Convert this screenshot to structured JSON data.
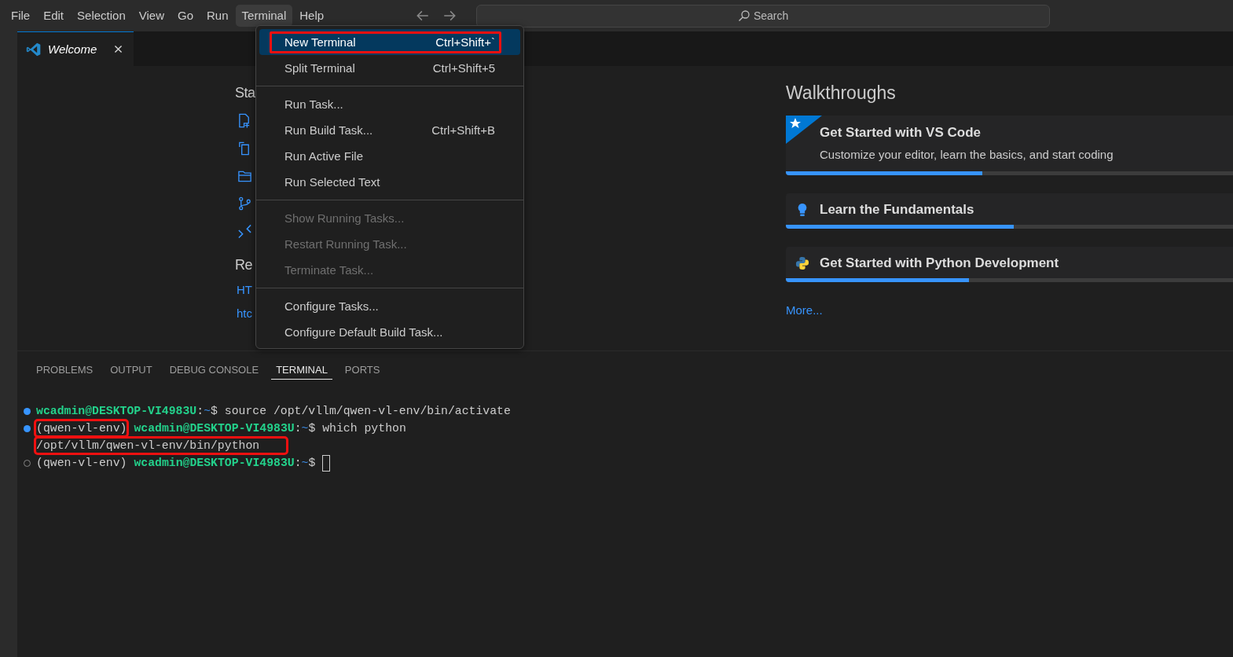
{
  "menu_bar": {
    "items": [
      {
        "label": "File",
        "selected": false
      },
      {
        "label": "Edit",
        "selected": false
      },
      {
        "label": "Selection",
        "selected": false
      },
      {
        "label": "View",
        "selected": false
      },
      {
        "label": "Go",
        "selected": false
      },
      {
        "label": "Run",
        "selected": false
      },
      {
        "label": "Terminal",
        "selected": true
      },
      {
        "label": "Help",
        "selected": false
      }
    ]
  },
  "command_center": {
    "label": "Search"
  },
  "tabs": [
    {
      "label": "Welcome",
      "selected": true
    }
  ],
  "welcome": {
    "start_heading": "Sta",
    "start_icons": [
      {
        "kind": "file"
      },
      {
        "kind": "clone"
      },
      {
        "kind": "folder"
      },
      {
        "kind": "branch"
      },
      {
        "kind": "remote"
      }
    ],
    "recent_heading": "Re",
    "recent_links": [
      "HT",
      "htc"
    ]
  },
  "walkthroughs": {
    "heading": "Walkthroughs",
    "items": [
      {
        "kind": "featured",
        "title": "Get Started with VS Code",
        "description": "Customize your editor, learn the basics, and start coding",
        "level": 0.44
      },
      {
        "kind": "bulb",
        "title": "Learn the Fundamentals",
        "level": 0.51
      },
      {
        "kind": "python",
        "title": "Get Started with Python Development",
        "level": 0.41
      }
    ],
    "more": "More..."
  },
  "menu": {
    "items": [
      {
        "kind": "item",
        "label": "New Terminal",
        "shortcut": "Ctrl+Shift+`",
        "selected": true,
        "disabled": false,
        "annotated": true
      },
      {
        "kind": "item",
        "label": "Split Terminal",
        "shortcut": "Ctrl+Shift+5",
        "selected": false,
        "disabled": false,
        "annotated": false
      },
      {
        "kind": "separator"
      },
      {
        "kind": "item",
        "label": "Run Task...",
        "selected": false,
        "disabled": false,
        "annotated": false
      },
      {
        "kind": "item",
        "label": "Run Build Task...",
        "shortcut": "Ctrl+Shift+B",
        "selected": false,
        "disabled": false,
        "annotated": false
      },
      {
        "kind": "item",
        "label": "Run Active File",
        "selected": false,
        "disabled": false,
        "annotated": false
      },
      {
        "kind": "item",
        "label": "Run Selected Text",
        "selected": false,
        "disabled": false,
        "annotated": false
      },
      {
        "kind": "separator"
      },
      {
        "kind": "item",
        "label": "Show Running Tasks...",
        "selected": false,
        "disabled": true,
        "annotated": false
      },
      {
        "kind": "item",
        "label": "Restart Running Task...",
        "selected": false,
        "disabled": true,
        "annotated": false
      },
      {
        "kind": "item",
        "label": "Terminate Task...",
        "selected": false,
        "disabled": true,
        "annotated": false
      },
      {
        "kind": "separator"
      },
      {
        "kind": "item",
        "label": "Configure Tasks...",
        "selected": false,
        "disabled": false,
        "annotated": false
      },
      {
        "kind": "item",
        "label": "Configure Default Build Task...",
        "selected": false,
        "disabled": false,
        "annotated": false
      }
    ]
  },
  "panel": {
    "tabs": [
      {
        "label": "PROBLEMS",
        "selected": false
      },
      {
        "label": "OUTPUT",
        "selected": false
      },
      {
        "label": "DEBUG CONSOLE",
        "selected": false
      },
      {
        "label": "TERMINAL",
        "selected": true
      },
      {
        "label": "PORTS",
        "selected": false
      }
    ],
    "terminal": {
      "lines": [
        {
          "kind": "command",
          "cursor": false,
          "segments": [
            {
              "text": "wcadmin@DESKTOP-VI4983U",
              "kind": "user",
              "annotated": false
            },
            {
              "text": ":",
              "kind": "plain",
              "annotated": false
            },
            {
              "text": "~",
              "kind": "dir",
              "annotated": false
            },
            {
              "text": "$ source /opt/vllm/qwen-vl-env/bin/activate",
              "kind": "plain",
              "annotated": false
            }
          ]
        },
        {
          "kind": "command",
          "cursor": false,
          "segments": [
            {
              "text": "(qwen-vl-env)",
              "kind": "plain",
              "annotated": true
            },
            {
              "text": "wcadmin@DESKTOP-VI4983U",
              "kind": "user",
              "annotated": false
            },
            {
              "text": ":",
              "kind": "plain",
              "annotated": false
            },
            {
              "text": "~",
              "kind": "dir",
              "annotated": false
            },
            {
              "text": "$ which python",
              "kind": "plain",
              "annotated": false
            }
          ]
        },
        {
          "kind": "output",
          "cursor": false,
          "segments": [
            {
              "text": "/opt/vllm/qwen-vl-env/bin/python",
              "kind": "plain",
              "annotated": true
            }
          ]
        },
        {
          "kind": "prompt",
          "cursor": true,
          "segments": [
            {
              "text": "(qwen-vl-env)",
              "kind": "plain",
              "annotated": false
            },
            {
              "text": "wcadmin@DESKTOP-VI4983U",
              "kind": "user",
              "annotated": false
            },
            {
              "text": ":",
              "kind": "plain",
              "annotated": false
            },
            {
              "text": "~",
              "kind": "dir",
              "annotated": false
            },
            {
              "text": "$",
              "kind": "plain",
              "annotated": false
            }
          ]
        }
      ]
    }
  }
}
